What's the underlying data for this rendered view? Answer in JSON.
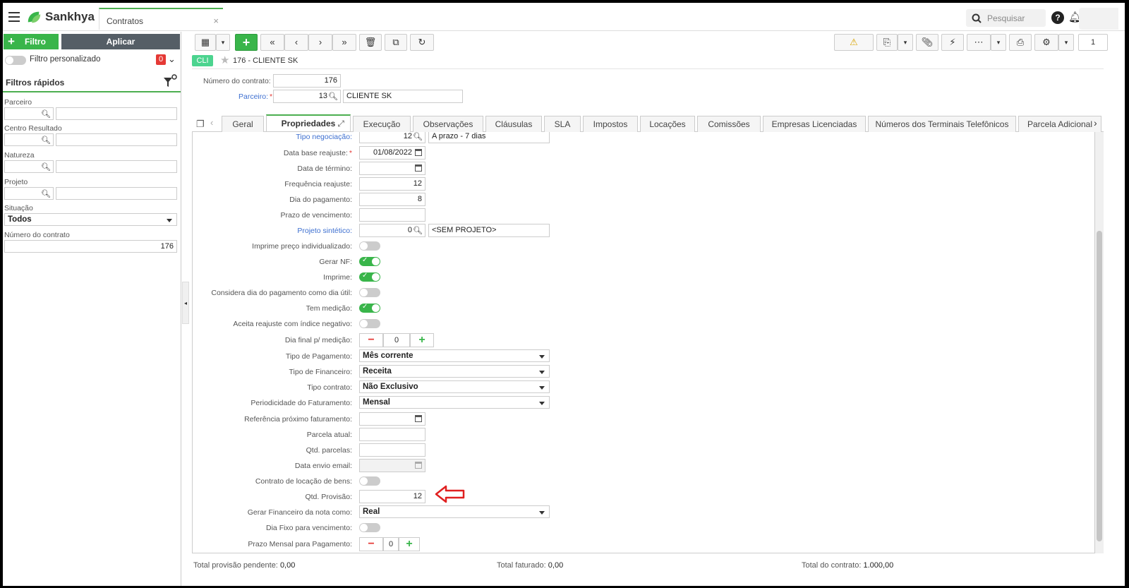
{
  "topbar": {
    "brand": "Sankhya",
    "doc_tab": "Contratos",
    "search_placeholder": "Pesquisar"
  },
  "left_panel": {
    "filter_button": "Filtro",
    "apply_button": "Aplicar",
    "custom_filter_label": "Filtro personalizado",
    "custom_filter_count": "0",
    "quick_filters_title": "Filtros rápidos",
    "fields": {
      "parceiro": "Parceiro",
      "centro_resultado": "Centro Resultado",
      "natureza": "Natureza",
      "projeto": "Projeto",
      "situacao": "Situação",
      "situacao_value": "Todos",
      "numero_contrato": "Número do contrato",
      "numero_contrato_value": "176"
    }
  },
  "record_header": {
    "badge": "CLI",
    "title": "176 - CLIENTE SK",
    "toolbar_page": "1"
  },
  "header_fields": {
    "numero_contrato_label": "Número do contrato:",
    "numero_contrato_value": "176",
    "parceiro_label": "Parceiro:",
    "parceiro_code": "13",
    "parceiro_name": "CLIENTE SK"
  },
  "tabs": [
    "Geral",
    "Propriedades",
    "Execução",
    "Observações",
    "Cláusulas",
    "SLA",
    "Impostos",
    "Locações",
    "Comissões",
    "Empresas Licenciadas",
    "Números dos Terminais Telefônicos",
    "Parcela Adicional"
  ],
  "form": {
    "tipo_negociacao": {
      "label": "Tipo negociação:",
      "code": "12",
      "desc": "A prazo - 7 dias"
    },
    "data_base_reajuste": {
      "label": "Data base reajuste:",
      "value": "01/08/2022"
    },
    "data_termino": {
      "label": "Data de término:",
      "value": ""
    },
    "frequencia_reajuste": {
      "label": "Frequência reajuste:",
      "value": "12"
    },
    "dia_pagamento": {
      "label": "Dia do pagamento:",
      "value": "8"
    },
    "prazo_vencimento": {
      "label": "Prazo de vencimento:",
      "value": ""
    },
    "projeto_sintetico": {
      "label": "Projeto sintético:",
      "code": "0",
      "desc": "<SEM PROJETO>"
    },
    "imprime_preco": {
      "label": "Imprime preço individualizado:",
      "on": false
    },
    "gerar_nf": {
      "label": "Gerar NF:",
      "on": true
    },
    "imprime": {
      "label": "Imprime:",
      "on": true
    },
    "considera_dia": {
      "label": "Considera dia do pagamento como dia útil:",
      "on": false
    },
    "tem_medicao": {
      "label": "Tem medição:",
      "on": true
    },
    "aceita_reajuste": {
      "label": "Aceita reajuste com índice negativo:",
      "on": false
    },
    "dia_final_medicao": {
      "label": "Dia final p/ medição:",
      "value": "0"
    },
    "tipo_pagamento": {
      "label": "Tipo de Pagamento:",
      "value": "Mês corrente"
    },
    "tipo_financeiro": {
      "label": "Tipo de Financeiro:",
      "value": "Receita"
    },
    "tipo_contrato": {
      "label": "Tipo contrato:",
      "value": "Não Exclusivo"
    },
    "periodicidade": {
      "label": "Periodicidade do Faturamento:",
      "value": "Mensal"
    },
    "referencia_faturamento": {
      "label": "Referência próximo faturamento:",
      "value": ""
    },
    "parcela_atual": {
      "label": "Parcela atual:",
      "value": ""
    },
    "qtd_parcelas": {
      "label": "Qtd. parcelas:",
      "value": ""
    },
    "data_envio_email": {
      "label": "Data envio email:",
      "value": ""
    },
    "contrato_locacao": {
      "label": "Contrato de locação de bens:",
      "on": false
    },
    "qtd_provisao": {
      "label": "Qtd. Provisão:",
      "value": "12"
    },
    "gerar_financeiro": {
      "label": "Gerar Financeiro da nota como:",
      "value": "Real"
    },
    "dia_fixo": {
      "label": "Dia Fixo para vencimento:",
      "on": false
    },
    "prazo_mensal": {
      "label": "Prazo Mensal para Pagamento:",
      "value": "0"
    }
  },
  "footer": {
    "provisao_label": "Total provisão pendente:",
    "provisao_value": "0,00",
    "faturado_label": "Total faturado:",
    "faturado_value": "0,00",
    "contrato_label": "Total do contrato:",
    "contrato_value": "1.000,00"
  },
  "colors": {
    "accent": "#39b54a",
    "link": "#3d6fd0",
    "badge": "#4cd48f",
    "arrow": "#e02020"
  }
}
